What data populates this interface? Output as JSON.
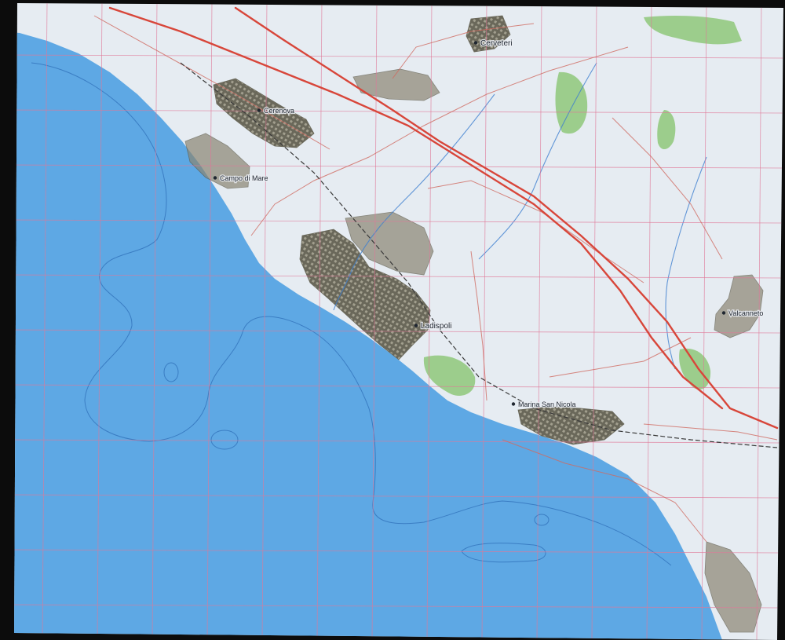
{
  "colors": {
    "sea": "#5ea8e4",
    "sea_deep": "#4f9ad9",
    "land": "#e6ecf2",
    "urban": "#5d5a4a",
    "urban_light": "#8a8572",
    "vegetation": "#8ec87a",
    "main_road": "#d8463a",
    "secondary_road": "#cf6a60",
    "grid": "#e07898",
    "river": "#3f7fd0",
    "isobath": "#2f6fb8",
    "scan_border": "#0c0c0c"
  },
  "places": [
    {
      "key": "cerveteri",
      "name": "Cerveteri",
      "kind": "town"
    },
    {
      "key": "cerenova",
      "name": "Cerenova",
      "kind": "town"
    },
    {
      "key": "campo-di-mare",
      "name": "Campo di Mare",
      "kind": "town"
    },
    {
      "key": "ladispoli",
      "name": "Ladispoli",
      "kind": "town"
    },
    {
      "key": "marina-san-nicola",
      "name": "Marina San Nicola",
      "kind": "town"
    },
    {
      "key": "valcanneto",
      "name": "Valcanneto",
      "kind": "town"
    }
  ],
  "layers": [
    "sea",
    "land",
    "vegetation",
    "urban",
    "roads",
    "rivers",
    "isobaths",
    "grid"
  ],
  "icons": {
    "settlement": "settlement-icon"
  }
}
